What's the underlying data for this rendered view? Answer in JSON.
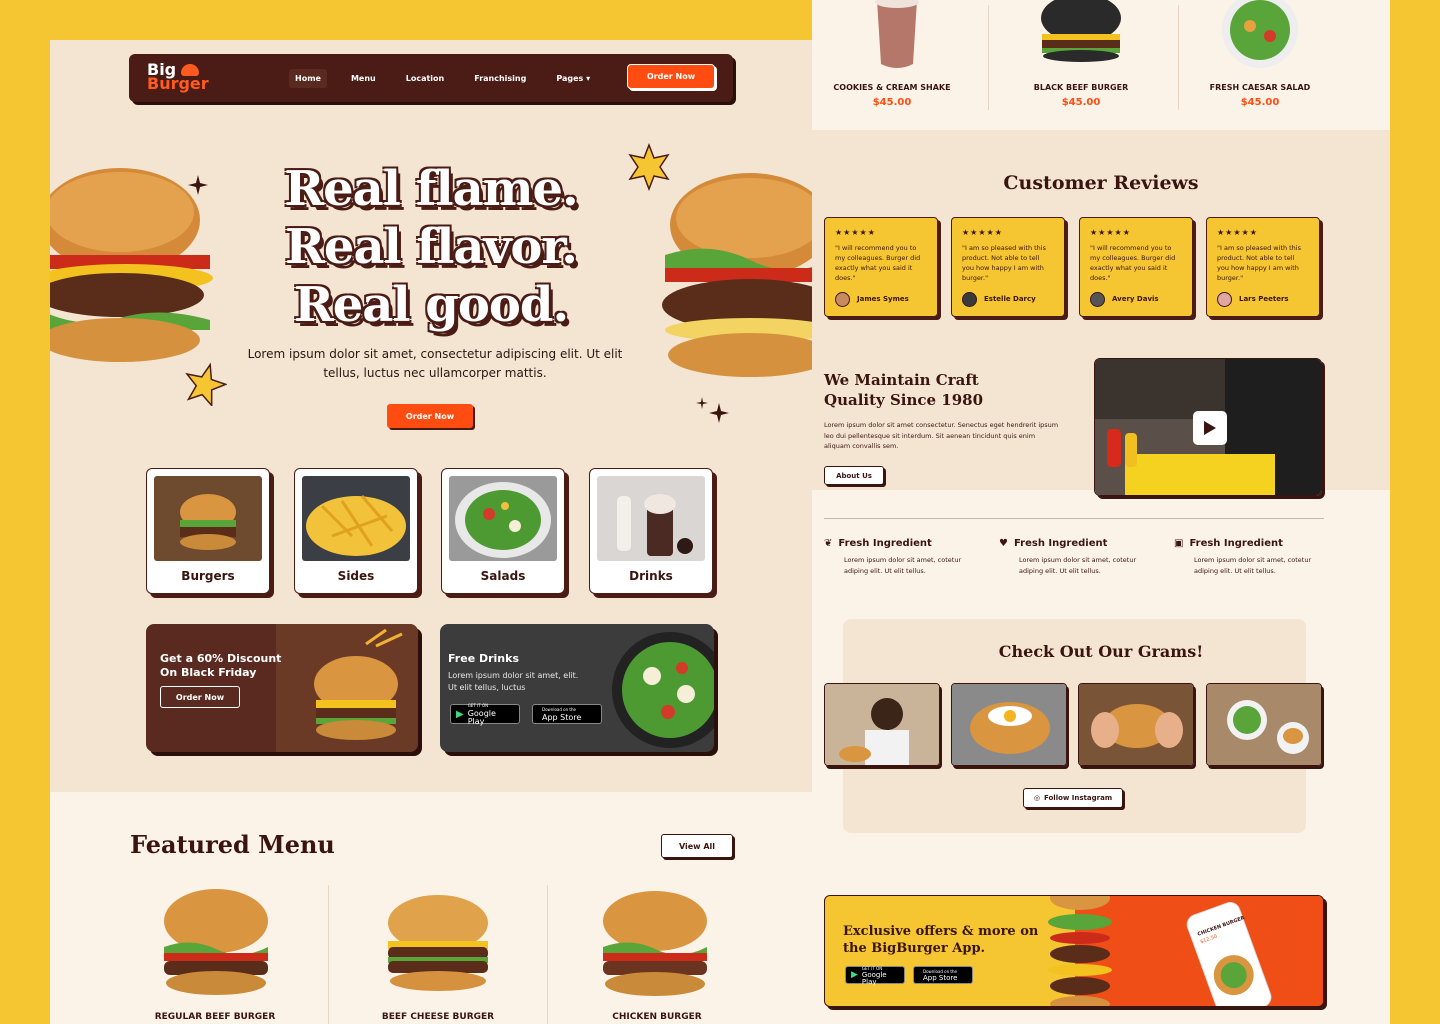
{
  "nav": {
    "logo_line1": "Big",
    "logo_line2": "Burger",
    "links": [
      "Home",
      "Menu",
      "Location",
      "Franchising",
      "Pages"
    ],
    "order_label": "Order Now"
  },
  "hero": {
    "title_lines": [
      "Real flame.",
      "Real flavor.",
      "Real good."
    ],
    "subtitle": "Lorem ipsum dolor sit amet, consectetur adipiscing elit. Ut elit tellus, luctus nec ullamcorper mattis.",
    "button": "Order Now"
  },
  "categories": [
    "Burgers",
    "Sides",
    "Salads",
    "Drinks"
  ],
  "promo_discount": {
    "title": "Get a 60% Discount On Black Friday",
    "button": "Order Now"
  },
  "promo_drinks": {
    "title": "Free Drinks",
    "desc": "Lorem ipsum dolor sit amet, elit. Ut elit tellus, luctus",
    "google_small": "GET IT ON",
    "google": "Google Play",
    "apple_small": "Download on the",
    "apple": "App Store"
  },
  "featured": {
    "title": "Featured Menu",
    "view_all": "View All",
    "items": [
      "REGULAR BEEF BURGER",
      "BEEF CHEESE BURGER",
      "CHICKEN BURGER"
    ]
  },
  "top_items": [
    {
      "name": "COOKIES & CREAM SHAKE",
      "price": "$45.00"
    },
    {
      "name": "BLACK BEEF BURGER",
      "price": "$45.00"
    },
    {
      "name": "FRESH CAESAR SALAD",
      "price": "$45.00"
    }
  ],
  "reviews": {
    "title": "Customer Reviews",
    "items": [
      {
        "stars": "★★★★★",
        "text": "\"I will recommend you to my colleagues. Burger did exactly what you said it does.\"",
        "name": "James Symes"
      },
      {
        "stars": "★★★★★",
        "text": "\"I am so pleased with this product. Not able to tell you how happy I am with burger.\"",
        "name": "Estelle Darcy"
      },
      {
        "stars": "★★★★★",
        "text": "\"I will recommend you to my colleagues. Burger did exactly what you said it does.\"",
        "name": "Avery Davis"
      },
      {
        "stars": "★★★★★",
        "text": "\"I am so pleased with this product. Not able to tell you how happy I am with burger.\"",
        "name": "Lars Peeters"
      }
    ]
  },
  "craft": {
    "title": "We Maintain Craft Quality Since 1980",
    "desc": "Lorem ipsum dolor sit amet consectetur. Senectus eget hendrerit ipsum leo dui pellentesque sit interdum. Sit aenean tincidunt quis enim aliquam convallis sem.",
    "button": "About Us"
  },
  "features": [
    {
      "title": "Fresh Ingredient",
      "desc": "Lorem ipsum dolor sit amet, cotetur adiping elit. Ut elit tellus.",
      "icon": "leaf-icon"
    },
    {
      "title": "Fresh Ingredient",
      "desc": "Lorem ipsum dolor sit amet, cotetur adiping elit. Ut elit tellus.",
      "icon": "heart-icon"
    },
    {
      "title": "Fresh Ingredient",
      "desc": "Lorem ipsum dolor sit amet, cotetur adiping elit. Ut elit tellus.",
      "icon": "ticket-icon"
    }
  ],
  "grams": {
    "title": "Check Out Our Grams!",
    "follow": "Follow Instagram"
  },
  "app": {
    "title": "Exclusive offers & more on the BigBurger App.",
    "google_small": "GET IT ON",
    "google": "Google Play",
    "apple_small": "Download on the",
    "apple": "App Store",
    "phone_title": "CHICKEN BURGER",
    "phone_price": "$12.50"
  },
  "colors": {
    "brand_brown": "#4a1c15",
    "accent_orange": "#ff4d12",
    "accent_yellow": "#f5c631",
    "cream": "#f4e5d3"
  }
}
